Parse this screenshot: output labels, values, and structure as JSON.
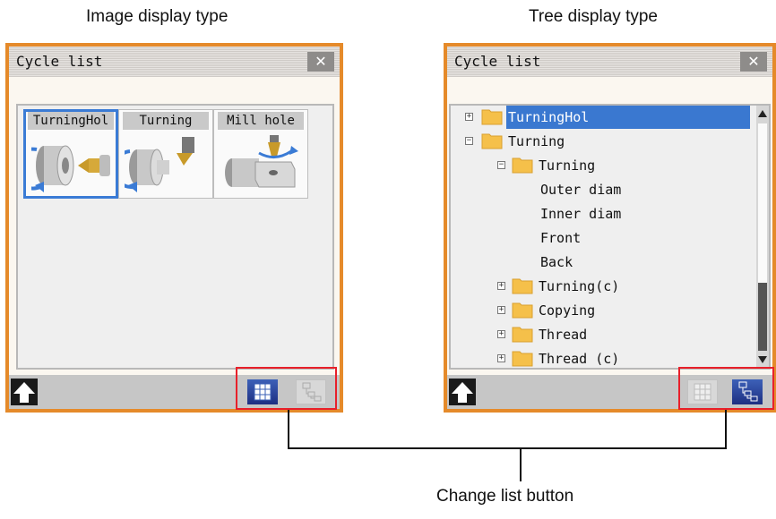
{
  "captions": {
    "left": "Image display type",
    "right": "Tree display type",
    "bottom": "Change list button"
  },
  "left_panel": {
    "title": "Cycle list",
    "close": "✕",
    "tiles": [
      {
        "label": "TurningHol",
        "icon": "turning-hole-icon",
        "selected": true
      },
      {
        "label": "Turning",
        "icon": "turning-icon",
        "selected": false
      },
      {
        "label": "Mill hole",
        "icon": "mill-hole-icon",
        "selected": false
      }
    ],
    "view_buttons": {
      "active": "image"
    }
  },
  "right_panel": {
    "title": "Cycle list",
    "close": "✕",
    "tree": [
      {
        "label": "TurningHol",
        "expander": "+",
        "folder": true,
        "level": 0,
        "selected": true
      },
      {
        "label": "Turning",
        "expander": "−",
        "folder": true,
        "level": 0,
        "selected": false
      },
      {
        "label": "Turning",
        "expander": "−",
        "folder": true,
        "level": 1,
        "selected": false
      },
      {
        "label": "Outer diam",
        "expander": "",
        "folder": false,
        "level": 2,
        "selected": false
      },
      {
        "label": "Inner diam",
        "expander": "",
        "folder": false,
        "level": 2,
        "selected": false
      },
      {
        "label": "Front",
        "expander": "",
        "folder": false,
        "level": 2,
        "selected": false
      },
      {
        "label": "Back",
        "expander": "",
        "folder": false,
        "level": 2,
        "selected": false
      },
      {
        "label": "Turning(c)",
        "expander": "+",
        "folder": true,
        "level": 1,
        "selected": false
      },
      {
        "label": "Copying",
        "expander": "+",
        "folder": true,
        "level": 1,
        "selected": false
      },
      {
        "label": "Thread",
        "expander": "+",
        "folder": true,
        "level": 1,
        "selected": false
      },
      {
        "label": "Thread (c)",
        "expander": "+",
        "folder": true,
        "level": 1,
        "selected": false
      }
    ],
    "view_buttons": {
      "active": "tree"
    }
  },
  "colors": {
    "panel_border": "#e58a2a",
    "selection": "#3a78d0",
    "callout": "#e8202a"
  }
}
